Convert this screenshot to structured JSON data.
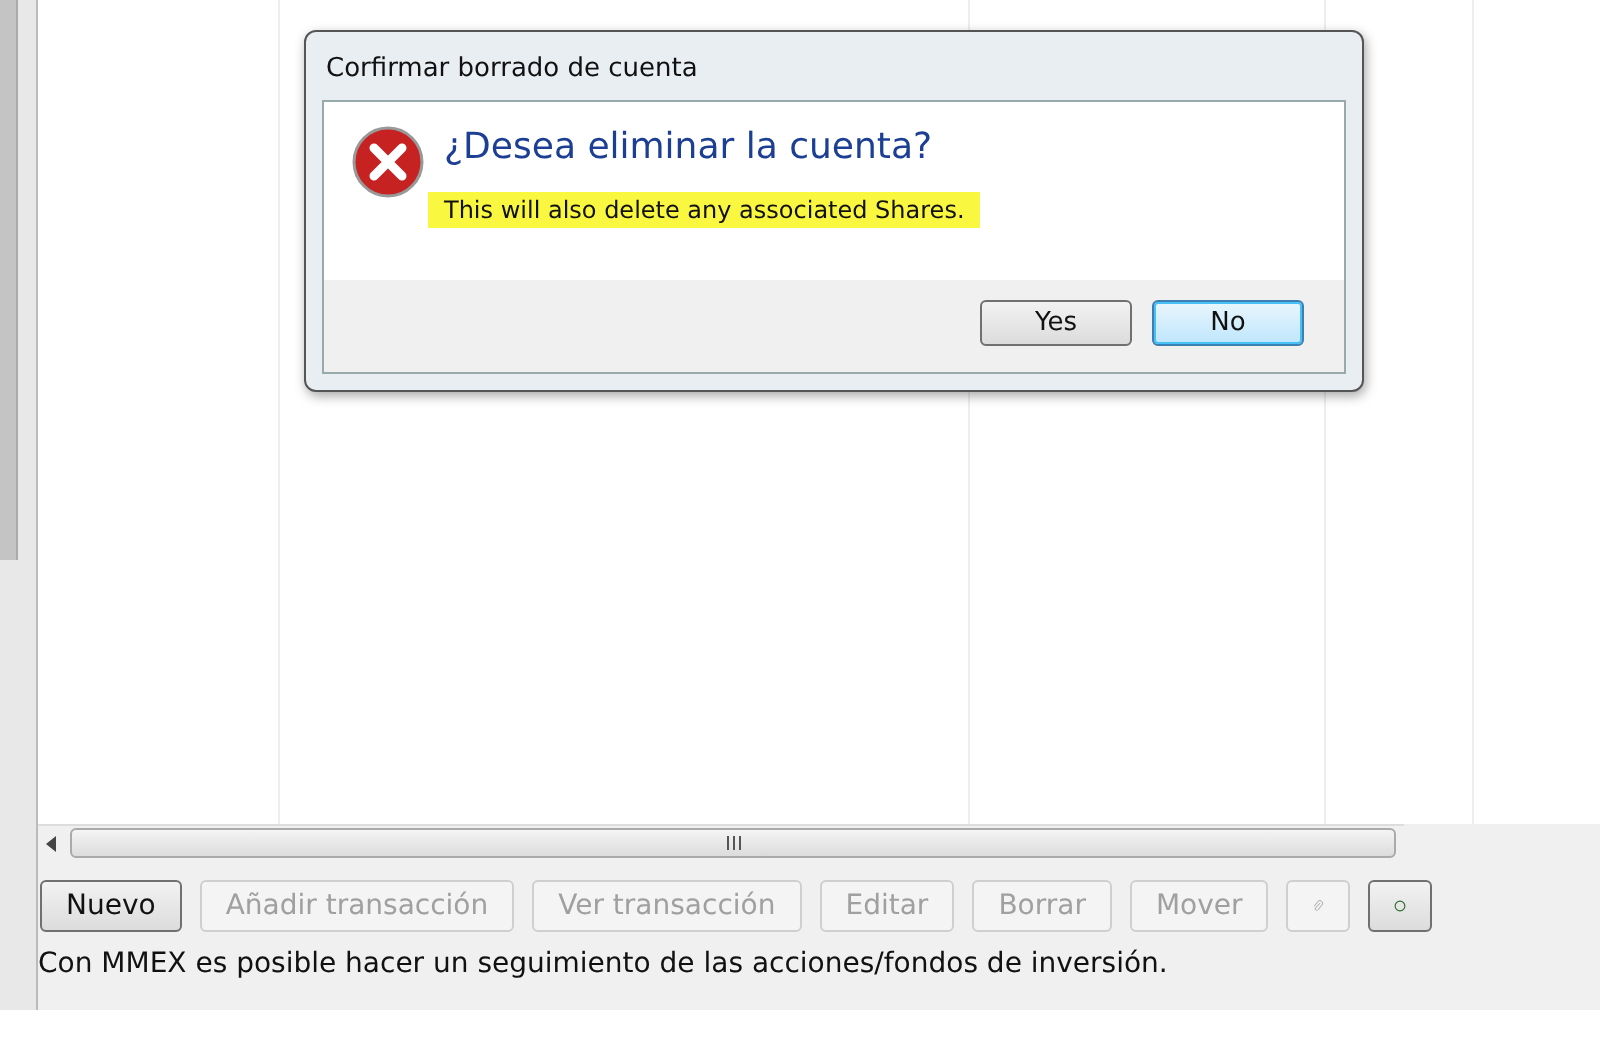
{
  "dialog": {
    "title": "Corfirmar borrado de cuenta",
    "heading": "¿Desea eliminar la cuenta?",
    "message": "This will also delete any associated Shares.",
    "message_highlighted": true,
    "buttons": [
      {
        "label": "Yes",
        "selected": false
      },
      {
        "label": "No",
        "selected": true
      }
    ]
  },
  "toolbar": [
    {
      "kind": "text",
      "label": "Nuevo",
      "disabled": false
    },
    {
      "kind": "text",
      "label": "Añadir transacción",
      "disabled": true
    },
    {
      "kind": "text",
      "label": "Ver transacción",
      "disabled": true
    },
    {
      "kind": "text",
      "label": "Editar",
      "disabled": true
    },
    {
      "kind": "text",
      "label": "Borrar",
      "disabled": true
    },
    {
      "kind": "text",
      "label": "Mover",
      "disabled": true
    },
    {
      "kind": "clip",
      "disabled": true
    },
    {
      "kind": "ring",
      "disabled": false
    }
  ],
  "status_bar": "Con MMEX es posible hacer un seguimiento de las acciones/fondos de inversión."
}
